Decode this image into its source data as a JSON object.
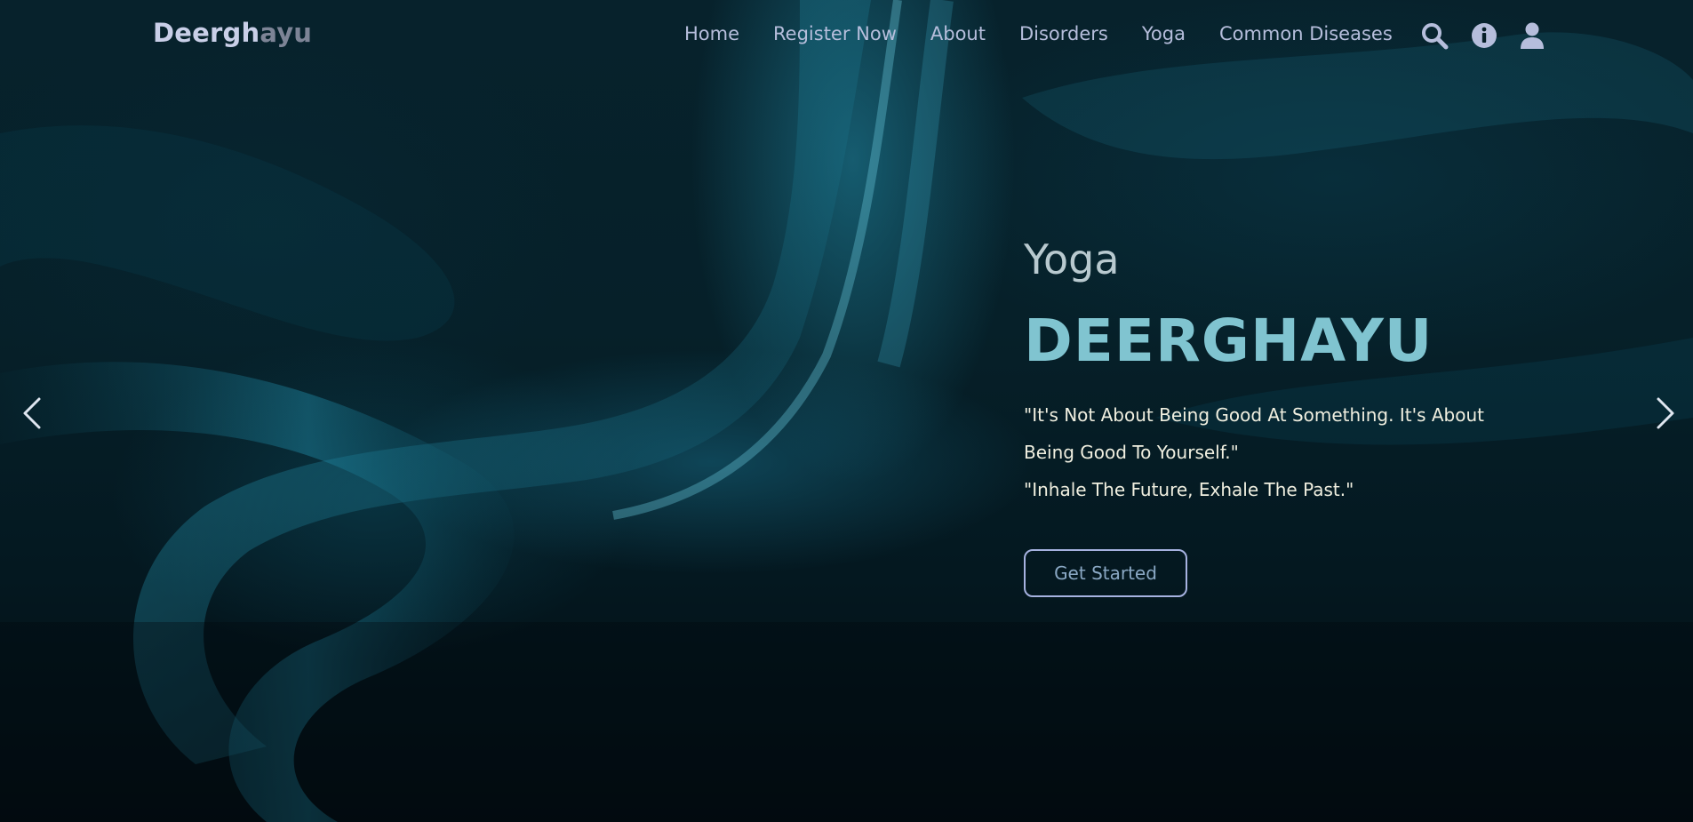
{
  "brand": {
    "logo_part1": "Deergh",
    "logo_part2": "ayu"
  },
  "nav": {
    "items": [
      {
        "label": "Home"
      },
      {
        "label": "Register Now"
      },
      {
        "label": "About"
      },
      {
        "label": "Disorders"
      },
      {
        "label": "Yoga"
      },
      {
        "label": "Common Diseases"
      }
    ],
    "icons": [
      "search-icon",
      "info-icon",
      "user-icon"
    ]
  },
  "hero": {
    "eyebrow": "Yoga",
    "headline": "DEERGHAYU",
    "quote1": "\"It's Not About Being Good At Something. It's About Being Good To Yourself.\"",
    "quote2": "\"Inhale The Future, Exhale The Past.\"",
    "cta_label": "Get Started"
  },
  "carousel": {
    "prev_icon": "chevron-left-icon",
    "next_icon": "chevron-right-icon"
  },
  "colors": {
    "background": "#062029",
    "accent": "#80c4d0",
    "nav_text": "#b6bedc",
    "button_border": "#a6b2e0"
  }
}
